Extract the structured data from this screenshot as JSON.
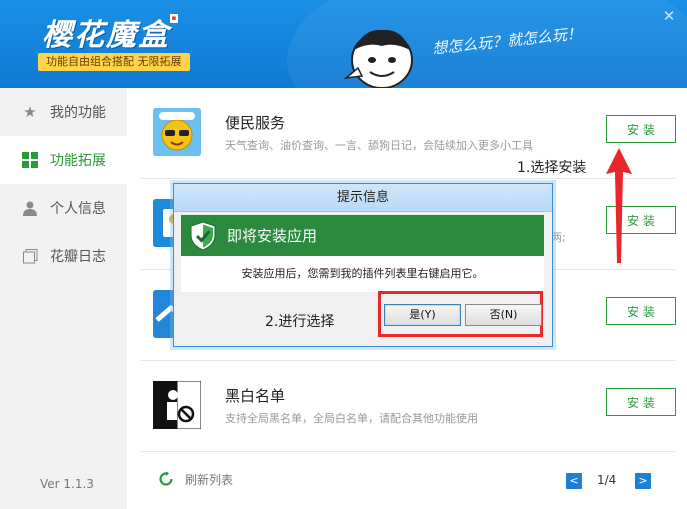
{
  "header": {
    "logo": "樱花魔盒",
    "tagline": "功能自由组合搭配  无限拓展",
    "slogan": "想怎么玩？就怎么玩！"
  },
  "sidebar": {
    "items": [
      {
        "label": "我的功能",
        "icon": "star-icon"
      },
      {
        "label": "功能拓展",
        "icon": "grid-icon",
        "active": true
      },
      {
        "label": "个人信息",
        "icon": "user-icon"
      },
      {
        "label": "花瓣日志",
        "icon": "log-icon"
      }
    ],
    "version": "Ver 1.1.3"
  },
  "list": {
    "rows": [
      {
        "title": "便民服务",
        "desc": "天气查询、油价查询、一言、舔狗日记，会陆续加入更多小工具",
        "button": "安装"
      },
      {
        "title": "",
        "desc": "",
        "desc_tail": "两;",
        "button": "安装"
      },
      {
        "title": "",
        "desc": "",
        "button": "安装"
      },
      {
        "title": "黑白名单",
        "desc": "支持全局黑名单，全局白名单，请配合其他功能使用",
        "button": "安装"
      }
    ],
    "refresh_label": "刷新列表",
    "pager": {
      "text": "1/4",
      "prev": "<",
      "next": ">"
    }
  },
  "annotations": {
    "step1": "1.选择安装",
    "step2": "2.进行选择"
  },
  "dialog": {
    "title": "提示信息",
    "heading": "即将安装应用",
    "body": "安装应用后，您需到我的插件列表里右键启用它。",
    "yes": "是(Y)",
    "no": "否(N)"
  },
  "colors": {
    "accent_green": "#2a9a3a",
    "header_blue": "#1584dd",
    "annotation_red": "#e8262c"
  }
}
